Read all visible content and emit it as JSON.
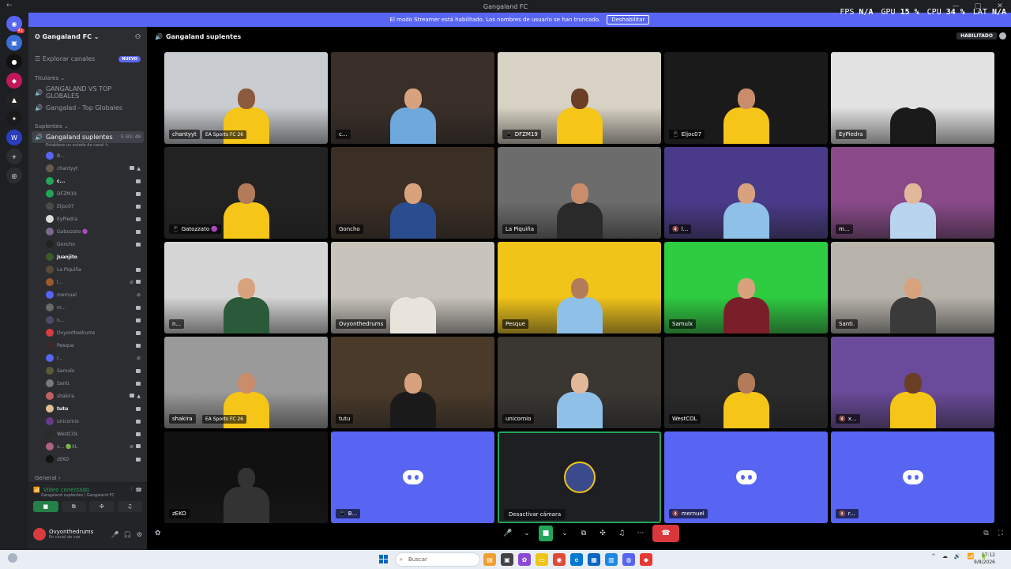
{
  "window": {
    "title": "Gangaland FC",
    "back": "←",
    "min": "—",
    "max": "▢",
    "close": "✕"
  },
  "banner": {
    "text": "El modo Streamer está habilitado. Los nombres de usuario se han truncado.",
    "button": "Deshabilitar"
  },
  "perf": {
    "fps_label": "FPS",
    "fps_value": "N/A",
    "gpu_label": "GPU",
    "gpu_value": "15 %",
    "cpu_label": "CPU",
    "cpu_value": "34 %",
    "lat_label": "LAT",
    "lat_value": "N/A"
  },
  "rail": {
    "servers": [
      {
        "color": "#5865f2",
        "glyph": "◉",
        "badge": "41"
      },
      {
        "color": "#3c6fd6",
        "glyph": "▣",
        "badge": ""
      },
      {
        "color": "#111111",
        "glyph": "●",
        "badge": ""
      },
      {
        "color": "#c2185b",
        "glyph": "◆",
        "badge": ""
      },
      {
        "color": "#222222",
        "glyph": "▲",
        "badge": ""
      },
      {
        "color": "#1a1a1a",
        "glyph": "✦",
        "badge": ""
      },
      {
        "color": "#2a3dbf",
        "glyph": "W",
        "badge": ""
      },
      {
        "color": "#2b2d31",
        "glyph": "+",
        "badge": ""
      },
      {
        "color": "#2b2d31",
        "glyph": "◎",
        "badge": ""
      }
    ]
  },
  "sidebar": {
    "server_name": "Gangaland FC",
    "explore": "Explorar canales",
    "explore_badge": "NUEVO",
    "categories": [
      {
        "name": "Titulares",
        "channels": [
          "GANGALAND VS TOP GLOBALES",
          "Gangalad - Top Globales"
        ]
      }
    ],
    "suplentes_category": "Suplentes",
    "active_channel": {
      "name": "Gangaland suplentes",
      "timer": "5:03:40",
      "status": "Establece un estado de canal"
    },
    "members": [
      {
        "name": "B...",
        "color": "#5865f2",
        "bold": false,
        "cam": false,
        "live": false,
        "muted": false
      },
      {
        "name": "chantyyt",
        "color": "#6b5a4b",
        "bold": false,
        "cam": true,
        "live": true,
        "muted": false
      },
      {
        "name": "c...",
        "color": "#23a55a",
        "bold": true,
        "cam": true,
        "live": false,
        "muted": false
      },
      {
        "name": "DFZM19",
        "color": "#23a55a",
        "bold": false,
        "cam": true,
        "live": false,
        "muted": false
      },
      {
        "name": "Eljoc07",
        "color": "#4a4a4a",
        "bold": false,
        "cam": true,
        "live": false,
        "muted": false
      },
      {
        "name": "EyPiedra",
        "color": "#dcdcdc",
        "bold": false,
        "cam": true,
        "live": false,
        "muted": false
      },
      {
        "name": "Gatozzato 🟣",
        "color": "#7a6a90",
        "bold": false,
        "cam": true,
        "live": false,
        "muted": false
      },
      {
        "name": "Goncho",
        "color": "#222222",
        "bold": false,
        "cam": true,
        "live": false,
        "muted": false
      },
      {
        "name": "Juanjito",
        "color": "#3a5a2a",
        "bold": true,
        "cam": false,
        "live": false,
        "muted": false
      },
      {
        "name": "La Piquiña",
        "color": "#5a4a3a",
        "bold": false,
        "cam": true,
        "live": false,
        "muted": false
      },
      {
        "name": "l...",
        "color": "#a05a2a",
        "bold": false,
        "cam": true,
        "live": false,
        "muted": true
      },
      {
        "name": "mernuel",
        "color": "#5865f2",
        "bold": false,
        "cam": false,
        "live": false,
        "muted": true
      },
      {
        "name": "m...",
        "color": "#6a6a6a",
        "bold": false,
        "cam": true,
        "live": false,
        "muted": false
      },
      {
        "name": "n...",
        "color": "#4a4a6a",
        "bold": false,
        "cam": true,
        "live": false,
        "muted": false
      },
      {
        "name": "Ovyonthedrums",
        "color": "#d83c3e",
        "bold": false,
        "cam": true,
        "live": false,
        "muted": false
      },
      {
        "name": "Pesque",
        "color": "#3a2a2a",
        "bold": false,
        "cam": true,
        "live": false,
        "muted": false
      },
      {
        "name": "r...",
        "color": "#5865f2",
        "bold": false,
        "cam": false,
        "live": false,
        "muted": true
      },
      {
        "name": "Samulx",
        "color": "#5a5a3a",
        "bold": false,
        "cam": true,
        "live": false,
        "muted": false
      },
      {
        "name": "Santi.",
        "color": "#7a7a7a",
        "bold": false,
        "cam": true,
        "live": false,
        "muted": false
      },
      {
        "name": "shakira",
        "color": "#c06060",
        "bold": false,
        "cam": true,
        "live": true,
        "muted": false
      },
      {
        "name": "tutu",
        "color": "#e0c090",
        "bold": true,
        "cam": true,
        "live": false,
        "muted": false
      },
      {
        "name": "unicornio",
        "color": "#6a3a8a",
        "bold": false,
        "cam": true,
        "live": false,
        "muted": false
      },
      {
        "name": "WestCOL",
        "color": "#2a2a2a",
        "bold": false,
        "cam": true,
        "live": false,
        "muted": false
      },
      {
        "name": "x... 🟢XL",
        "color": "#b06080",
        "bold": false,
        "cam": true,
        "live": false,
        "muted": true
      },
      {
        "name": "zEKO",
        "color": "#111111",
        "bold": false,
        "cam": true,
        "live": false,
        "muted": false
      }
    ],
    "general_category": "General",
    "voice_panel": {
      "status": "Vídeo conectado",
      "location": "Gangaland suplentes / Gangaland FC"
    },
    "user": {
      "name": "Ovyonthedrums",
      "status": "En canal de voz"
    }
  },
  "main": {
    "channel_name": "Gangaland suplentes",
    "streamer_badge": "HABILITADO",
    "tooltip": "Desactivar cámara",
    "controls": {
      "mic": "🎤",
      "mic_arrow": "⌄",
      "cam": "■",
      "cam_arrow": "⌄",
      "share": "⧉",
      "activities": "✣",
      "soundboard": "♫",
      "more": "···",
      "hangup": "☎",
      "popout": "⧉",
      "fullscreen": "⛶",
      "gift": "✿"
    },
    "tiles": [
      {
        "label": "chantyyt",
        "extra": "EA Sports FC 26",
        "icon": "",
        "speaking": false,
        "type": "video",
        "bg": "#c9ccd0",
        "shirt": "#f5c518",
        "skin": "#8c5a3c"
      },
      {
        "label": "c...",
        "extra": "",
        "icon": "",
        "speaking": true,
        "type": "video",
        "bg": "#3a2f28",
        "shirt": "#6fa8dc",
        "skin": "#d9a27f"
      },
      {
        "label": "DFZM19",
        "extra": "",
        "icon": "📱",
        "speaking": false,
        "type": "video",
        "bg": "#d8d2c4",
        "shirt": "#f5c518",
        "skin": "#6b3e26"
      },
      {
        "label": "Eljoc07",
        "extra": "",
        "icon": "📱",
        "speaking": false,
        "type": "video",
        "bg": "#1a1a1a",
        "shirt": "#f5c518",
        "skin": "#c98d6b"
      },
      {
        "label": "EyPiedra",
        "extra": "",
        "icon": "",
        "speaking": false,
        "type": "video",
        "bg": "#e2e2e2",
        "shirt": "#1a1a1a",
        "skin": "#e2e2e2"
      },
      {
        "label": "Gatozzato 🟣",
        "extra": "",
        "icon": "📱",
        "speaking": false,
        "type": "video",
        "bg": "#222222",
        "shirt": "#f5c518",
        "skin": "#b37b5a"
      },
      {
        "label": "Goncho",
        "extra": "",
        "icon": "",
        "speaking": false,
        "type": "video",
        "bg": "#3b2e24",
        "shirt": "#2a4d8f",
        "skin": "#d9a27f"
      },
      {
        "label": "La Piquiña",
        "extra": "",
        "icon": "",
        "speaking": false,
        "type": "video",
        "bg": "#6c6c6c",
        "shirt": "#2a2a2a",
        "skin": "#c98d6b"
      },
      {
        "label": "l...",
        "extra": "",
        "icon": "🔇",
        "speaking": false,
        "type": "video",
        "bg": "#4a3a8a",
        "shirt": "#8fc0e8",
        "skin": "#d9a27f"
      },
      {
        "label": "m...",
        "extra": "",
        "icon": "",
        "speaking": false,
        "type": "video",
        "bg": "#8a4a8a",
        "shirt": "#b8d4ef",
        "skin": "#e2b89a"
      },
      {
        "label": "n...",
        "extra": "",
        "icon": "",
        "speaking": false,
        "type": "video",
        "bg": "#d6d6d6",
        "shirt": "#2a5a3a",
        "skin": "#d9a27f"
      },
      {
        "label": "Ovyonthedrums",
        "extra": "",
        "icon": "",
        "speaking": false,
        "type": "video",
        "bg": "#c8c4bc",
        "shirt": "#e8e4dc",
        "skin": "#c8c4bc"
      },
      {
        "label": "Pesque",
        "extra": "",
        "icon": "",
        "speaking": false,
        "type": "video",
        "bg": "#f0c419",
        "shirt": "#8fc0e8",
        "skin": "#b37b5a"
      },
      {
        "label": "Samulx",
        "extra": "",
        "icon": "",
        "speaking": false,
        "type": "video",
        "bg": "#2ecc40",
        "shirt": "#7a1f2a",
        "skin": "#d9a27f"
      },
      {
        "label": "Santi.",
        "extra": "",
        "icon": "",
        "speaking": false,
        "type": "video",
        "bg": "#b8b4ac",
        "shirt": "#3a3a3a",
        "skin": "#d9a27f"
      },
      {
        "label": "shakira",
        "extra": "EA Sports FC 26",
        "icon": "",
        "speaking": false,
        "type": "video",
        "bg": "#9a9a9a",
        "shirt": "#f5c518",
        "skin": "#c98d6b"
      },
      {
        "label": "tutu",
        "extra": "",
        "icon": "",
        "speaking": true,
        "type": "video",
        "bg": "#4a3a2a",
        "shirt": "#1a1a1a",
        "skin": "#d9a27f"
      },
      {
        "label": "unicornio",
        "extra": "",
        "icon": "",
        "speaking": false,
        "type": "video",
        "bg": "#3a3632",
        "shirt": "#8fc0e8",
        "skin": "#e2b89a"
      },
      {
        "label": "WestCOL",
        "extra": "",
        "icon": "",
        "speaking": false,
        "type": "video",
        "bg": "#2a2a2a",
        "shirt": "#f5c518",
        "skin": "#b37b5a"
      },
      {
        "label": "x...",
        "extra": "",
        "icon": "🔇",
        "speaking": false,
        "type": "video",
        "bg": "#6a4a9a",
        "shirt": "#f5c518",
        "skin": "#6b3e26"
      },
      {
        "label": "zEKO",
        "extra": "",
        "icon": "",
        "speaking": false,
        "type": "video",
        "bg": "#111111",
        "shirt": "#333333",
        "skin": "#333333"
      },
      {
        "label": "B...",
        "extra": "",
        "icon": "📱",
        "speaking": false,
        "type": "placeholder"
      },
      {
        "label": "",
        "extra": "",
        "icon": "",
        "speaking": true,
        "type": "avatar"
      },
      {
        "label": "mernuel",
        "extra": "",
        "icon": "🔇",
        "speaking": false,
        "type": "placeholder"
      },
      {
        "label": "r...",
        "extra": "",
        "icon": "🔇",
        "speaking": false,
        "type": "placeholder"
      }
    ]
  },
  "taskbar": {
    "search_placeholder": "Buscar",
    "apps": [
      {
        "color": "#f0a030",
        "glyph": "▤"
      },
      {
        "color": "#444444",
        "glyph": "▣"
      },
      {
        "color": "#8a4ad6",
        "glyph": "✿"
      },
      {
        "color": "#f0c419",
        "glyph": "▭"
      },
      {
        "color": "#dd4b39",
        "glyph": "◉"
      },
      {
        "color": "#0078d4",
        "glyph": "e"
      },
      {
        "color": "#0a66c2",
        "glyph": "▦"
      },
      {
        "color": "#1e88e5",
        "glyph": "▥"
      },
      {
        "color": "#5865f2",
        "glyph": "◍"
      },
      {
        "color": "#e53935",
        "glyph": "◆"
      }
    ],
    "tray": [
      "^",
      "☁",
      "🔊",
      "📶",
      "🔋"
    ],
    "time": "17:12",
    "date": "9/8/2026"
  }
}
